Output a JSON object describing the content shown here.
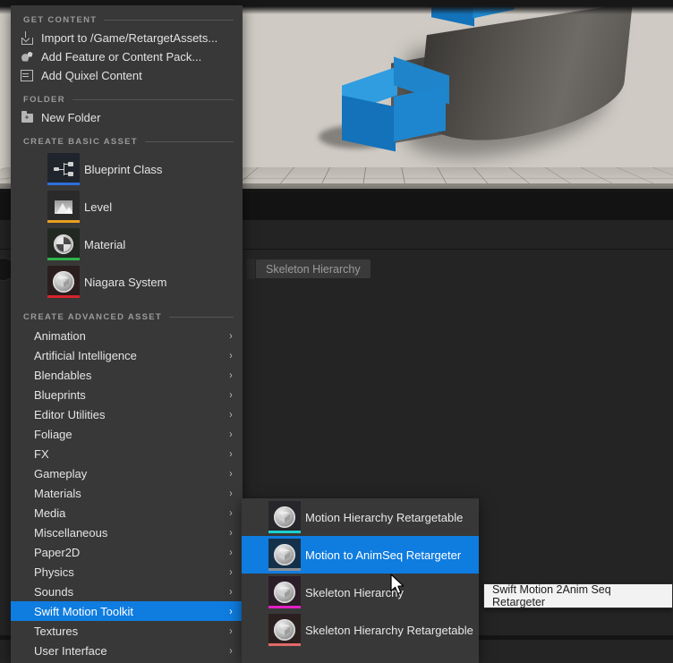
{
  "app": {
    "viewport_name": "level-viewport",
    "tab_label": "Skeleton Hierarchy"
  },
  "context_menu": {
    "sections": [
      {
        "title": "GET CONTENT",
        "items": [
          {
            "label": "Import to /Game/RetargetAssets...",
            "icon": "import-icon"
          },
          {
            "label": "Add Feature or Content Pack...",
            "icon": "content-pack-icon"
          },
          {
            "label": "Add Quixel Content",
            "icon": "quixel-icon"
          }
        ]
      },
      {
        "title": "FOLDER",
        "items": [
          {
            "label": "New Folder",
            "icon": "new-folder-icon"
          }
        ]
      }
    ],
    "basic_asset": {
      "title": "CREATE BASIC ASSET",
      "items": [
        {
          "label": "Blueprint Class",
          "icon": "blueprint-class-icon",
          "bar_color": "#2d6fdb",
          "tile_color": "#20242c"
        },
        {
          "label": "Level",
          "icon": "level-icon",
          "bar_color": "#e8a020",
          "tile_color": "#2a2a2a"
        },
        {
          "label": "Material",
          "icon": "material-icon",
          "bar_color": "#2fb34a",
          "tile_color": "#222822"
        },
        {
          "label": "Niagara System",
          "icon": "niagara-system-icon",
          "bar_color": "#d6242b",
          "tile_color": "#2b1e1e"
        }
      ]
    },
    "advanced_asset": {
      "title": "CREATE ADVANCED ASSET",
      "selected": "Swift Motion Toolkit",
      "highlight_color": "#0f7ce0",
      "items": [
        {
          "label": "Animation"
        },
        {
          "label": "Artificial Intelligence"
        },
        {
          "label": "Blendables"
        },
        {
          "label": "Blueprints"
        },
        {
          "label": "Editor Utilities"
        },
        {
          "label": "Foliage"
        },
        {
          "label": "FX"
        },
        {
          "label": "Gameplay"
        },
        {
          "label": "Materials"
        },
        {
          "label": "Media"
        },
        {
          "label": "Miscellaneous"
        },
        {
          "label": "Paper2D"
        },
        {
          "label": "Physics"
        },
        {
          "label": "Sounds"
        },
        {
          "label": "Swift Motion Toolkit"
        },
        {
          "label": "Textures"
        },
        {
          "label": "User Interface"
        }
      ],
      "submenu_arrow": "›"
    }
  },
  "submenu": {
    "selected": "Motion to AnimSeq Retargeter",
    "highlight_color": "#0f7ce0",
    "items": [
      {
        "label": "Motion Hierarchy Retargetable",
        "icon": "asset-cube-icon",
        "bar_color": "#1ed0d0",
        "tile_color": "#26262b"
      },
      {
        "label": "Motion to AnimSeq Retargeter",
        "icon": "asset-cube-icon",
        "bar_color": "#8c9096",
        "tile_color": "#15314a"
      },
      {
        "label": "Skeleton Hierarchy",
        "icon": "asset-cube-icon",
        "bar_color": "#e520c8",
        "tile_color": "#2b1e28"
      },
      {
        "label": "Skeleton Hierarchy Retargetable",
        "icon": "asset-cube-icon",
        "bar_color": "#e06a6a",
        "tile_color": "#2b2020"
      }
    ]
  },
  "tooltip": {
    "text": "Swift Motion 2Anim Seq Retargeter"
  }
}
